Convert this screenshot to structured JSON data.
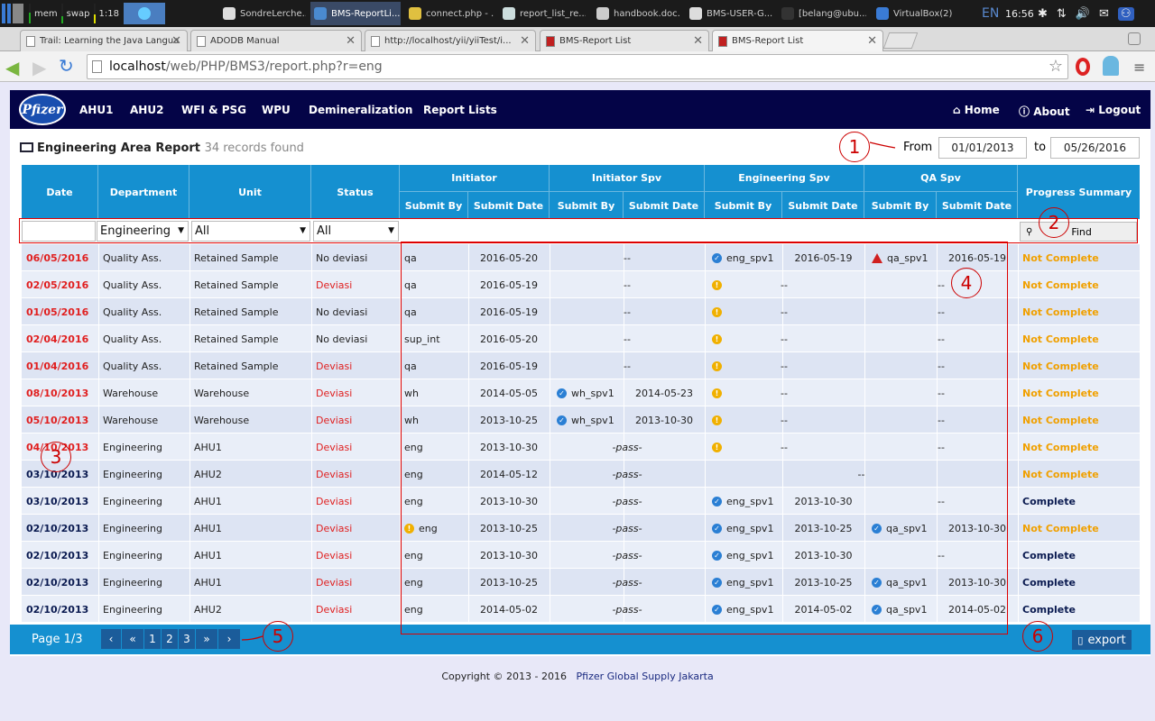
{
  "taskbar": {
    "mem": "mem",
    "swap": "swap",
    "clock_left": "1:18",
    "tasks": [
      {
        "label": "SondreLerche...",
        "active": false
      },
      {
        "label": "BMS-ReportLi...",
        "active": true
      },
      {
        "label": "connect.php - ...",
        "active": false
      },
      {
        "label": "report_list_re...",
        "active": false
      },
      {
        "label": "handbook.doc...",
        "active": false
      },
      {
        "label": "BMS-USER-G...",
        "active": false
      },
      {
        "label": "[belang@ubu...",
        "active": false
      },
      {
        "label": "VirtualBox(2)",
        "active": false
      }
    ],
    "lang": "EN",
    "time": "16:56"
  },
  "tabs": [
    {
      "label": "Trail: Learning the Java Langua",
      "active": false
    },
    {
      "label": "ADODB Manual",
      "active": false
    },
    {
      "label": "http://localhost/yii/yiiTest/i...",
      "active": false
    },
    {
      "label": "BMS-Report List",
      "active": false
    },
    {
      "label": "BMS-Report List",
      "active": true
    }
  ],
  "address": {
    "host": "localhost",
    "path": "/web/PHP/BMS3/report.php?r=eng"
  },
  "nav": {
    "logo": "Pfizer",
    "items": [
      "AHU1",
      "AHU2",
      "WFI & PSG",
      "WPU",
      "Demineralization",
      "Report Lists"
    ],
    "right": [
      "Home",
      "About",
      "Logout"
    ]
  },
  "report": {
    "title": "Engineering Area Report",
    "count": "34 records found",
    "from_label": "From",
    "from": "01/01/2013",
    "to_label": "to",
    "to": "05/26/2016"
  },
  "table": {
    "headers": {
      "date": "Date",
      "department": "Department",
      "unit": "Unit",
      "status": "Status",
      "initiator": "Initiator",
      "initiator_spv": "Initiator Spv",
      "engineering_spv": "Engineering Spv",
      "qa_spv": "QA Spv",
      "progress": "Progress Summary",
      "submit_by": "Submit By",
      "submit_date": "Submit Date"
    },
    "filter": {
      "department": "Engineering",
      "unit": "All",
      "status": "All",
      "find": "Find"
    },
    "rows": [
      {
        "date": "06/05/2016",
        "date_red": true,
        "dept": "Quality Ass.",
        "unit": "Retained Sample",
        "status": "No deviasi",
        "init_icon": "",
        "init_by": "qa",
        "init_date": "2016-05-20",
        "ispv_icon": "",
        "ispv_by": "",
        "ispv_date": "",
        "ispv_merged": "--",
        "ispv_pass": false,
        "eng_icon": "ok",
        "eng_by": "eng_spv1",
        "eng_date": "2016-05-19",
        "eng_merged": "",
        "qa_icon": "alert",
        "qa_by": "qa_spv1",
        "qa_date": "2016-05-19",
        "qa_merged": "",
        "progress": "Not Complete"
      },
      {
        "date": "02/05/2016",
        "date_red": true,
        "dept": "Quality Ass.",
        "unit": "Retained Sample",
        "status": "Deviasi",
        "init_icon": "",
        "init_by": "qa",
        "init_date": "2016-05-19",
        "ispv_merged": "--",
        "ispv_pass": false,
        "eng_icon": "warn",
        "eng_merged": "--",
        "qa_merged": "--",
        "progress": "Not Complete"
      },
      {
        "date": "01/05/2016",
        "date_red": true,
        "dept": "Quality Ass.",
        "unit": "Retained Sample",
        "status": "No deviasi",
        "init_icon": "",
        "init_by": "qa",
        "init_date": "2016-05-19",
        "ispv_merged": "--",
        "ispv_pass": false,
        "eng_icon": "warn",
        "eng_merged": "--",
        "qa_merged": "--",
        "progress": "Not Complete"
      },
      {
        "date": "02/04/2016",
        "date_red": true,
        "dept": "Quality Ass.",
        "unit": "Retained Sample",
        "status": "No deviasi",
        "init_icon": "",
        "init_by": "sup_int",
        "init_date": "2016-05-20",
        "ispv_merged": "--",
        "ispv_pass": false,
        "eng_icon": "warn",
        "eng_merged": "--",
        "qa_merged": "--",
        "progress": "Not Complete"
      },
      {
        "date": "01/04/2016",
        "date_red": true,
        "dept": "Quality Ass.",
        "unit": "Retained Sample",
        "status": "Deviasi",
        "init_icon": "",
        "init_by": "qa",
        "init_date": "2016-05-19",
        "ispv_merged": "--",
        "ispv_pass": false,
        "eng_icon": "warn",
        "eng_merged": "--",
        "qa_merged": "--",
        "progress": "Not Complete"
      },
      {
        "date": "08/10/2013",
        "date_red": true,
        "dept": "Warehouse",
        "unit": "Warehouse",
        "status": "Deviasi",
        "init_icon": "",
        "init_by": "wh",
        "init_date": "2014-05-05",
        "ispv_icon": "ok",
        "ispv_by": "wh_spv1",
        "ispv_date": "2014-05-23",
        "ispv_merged": "",
        "ispv_pass": false,
        "eng_icon": "warn",
        "eng_merged": "--",
        "qa_merged": "--",
        "progress": "Not Complete"
      },
      {
        "date": "05/10/2013",
        "date_red": true,
        "dept": "Warehouse",
        "unit": "Warehouse",
        "status": "Deviasi",
        "init_icon": "",
        "init_by": "wh",
        "init_date": "2013-10-25",
        "ispv_icon": "ok",
        "ispv_by": "wh_spv1",
        "ispv_date": "2013-10-30",
        "ispv_merged": "",
        "ispv_pass": false,
        "eng_icon": "warn",
        "eng_merged": "--",
        "qa_merged": "--",
        "progress": "Not Complete"
      },
      {
        "date": "04/10/2013",
        "date_red": true,
        "dept": "Engineering",
        "unit": "AHU1",
        "status": "Deviasi",
        "init_icon": "",
        "init_by": "eng",
        "init_date": "2013-10-30",
        "ispv_merged": "-pass-",
        "ispv_pass": true,
        "eng_icon": "warn",
        "eng_merged": "--",
        "qa_merged": "--",
        "progress": "Not Complete"
      },
      {
        "date": "03/10/2013",
        "date_red": false,
        "dept": "Engineering",
        "unit": "AHU2",
        "status": "Deviasi",
        "init_icon": "",
        "init_by": "eng",
        "init_date": "2014-05-12",
        "ispv_merged": "-pass-",
        "ispv_pass": true,
        "eng_icon": "",
        "eng_merged": "--",
        "eng_wide": true,
        "qa_merged": "",
        "progress": "Not Complete"
      },
      {
        "date": "03/10/2013",
        "date_red": false,
        "dept": "Engineering",
        "unit": "AHU1",
        "status": "Deviasi",
        "init_icon": "",
        "init_by": "eng",
        "init_date": "2013-10-30",
        "ispv_merged": "-pass-",
        "ispv_pass": true,
        "eng_icon": "ok",
        "eng_by": "eng_spv1",
        "eng_date": "2013-10-30",
        "eng_merged": "",
        "qa_merged": "--",
        "progress": "Complete"
      },
      {
        "date": "02/10/2013",
        "date_red": false,
        "dept": "Engineering",
        "unit": "AHU1",
        "status": "Deviasi",
        "init_icon": "warn",
        "init_by": "eng",
        "init_date": "2013-10-25",
        "ispv_merged": "-pass-",
        "ispv_pass": true,
        "eng_icon": "ok",
        "eng_by": "eng_spv1",
        "eng_date": "2013-10-25",
        "eng_merged": "",
        "qa_icon": "ok",
        "qa_by": "qa_spv1",
        "qa_date": "2013-10-30",
        "qa_merged": "",
        "progress": "Not Complete"
      },
      {
        "date": "02/10/2013",
        "date_red": false,
        "dept": "Engineering",
        "unit": "AHU1",
        "status": "Deviasi",
        "init_icon": "",
        "init_by": "eng",
        "init_date": "2013-10-30",
        "ispv_merged": "-pass-",
        "ispv_pass": true,
        "eng_icon": "ok",
        "eng_by": "eng_spv1",
        "eng_date": "2013-10-30",
        "eng_merged": "",
        "qa_merged": "--",
        "progress": "Complete"
      },
      {
        "date": "02/10/2013",
        "date_red": false,
        "dept": "Engineering",
        "unit": "AHU1",
        "status": "Deviasi",
        "init_icon": "",
        "init_by": "eng",
        "init_date": "2013-10-25",
        "ispv_merged": "-pass-",
        "ispv_pass": true,
        "eng_icon": "ok",
        "eng_by": "eng_spv1",
        "eng_date": "2013-10-25",
        "eng_merged": "",
        "qa_icon": "ok",
        "qa_by": "qa_spv1",
        "qa_date": "2013-10-30",
        "qa_merged": "",
        "progress": "Complete"
      },
      {
        "date": "02/10/2013",
        "date_red": false,
        "dept": "Engineering",
        "unit": "AHU2",
        "status": "Deviasi",
        "init_icon": "",
        "init_by": "eng",
        "init_date": "2014-05-02",
        "ispv_merged": "-pass-",
        "ispv_pass": true,
        "eng_icon": "ok",
        "eng_by": "eng_spv1",
        "eng_date": "2014-05-02",
        "eng_merged": "",
        "qa_icon": "ok",
        "qa_by": "qa_spv1",
        "qa_date": "2014-05-02",
        "qa_merged": "",
        "progress": "Complete"
      }
    ]
  },
  "pagination": {
    "label": "Page 1/3",
    "pages": [
      "1",
      "2",
      "3"
    ],
    "prev": "‹",
    "first": "«",
    "last": "»",
    "next": "›",
    "export": "export"
  },
  "annotations": [
    "1",
    "2",
    "3",
    "4",
    "5",
    "6"
  ],
  "footer": {
    "copyright": "Copyright © 2013 - 2016",
    "company": "Pfizer Global Supply Jakarta"
  },
  "colors": {
    "nav_bg": "#040447",
    "header_bg": "#1590d0",
    "red": "#e02020",
    "orange": "#f0a000",
    "navy": "#0a1a50"
  }
}
